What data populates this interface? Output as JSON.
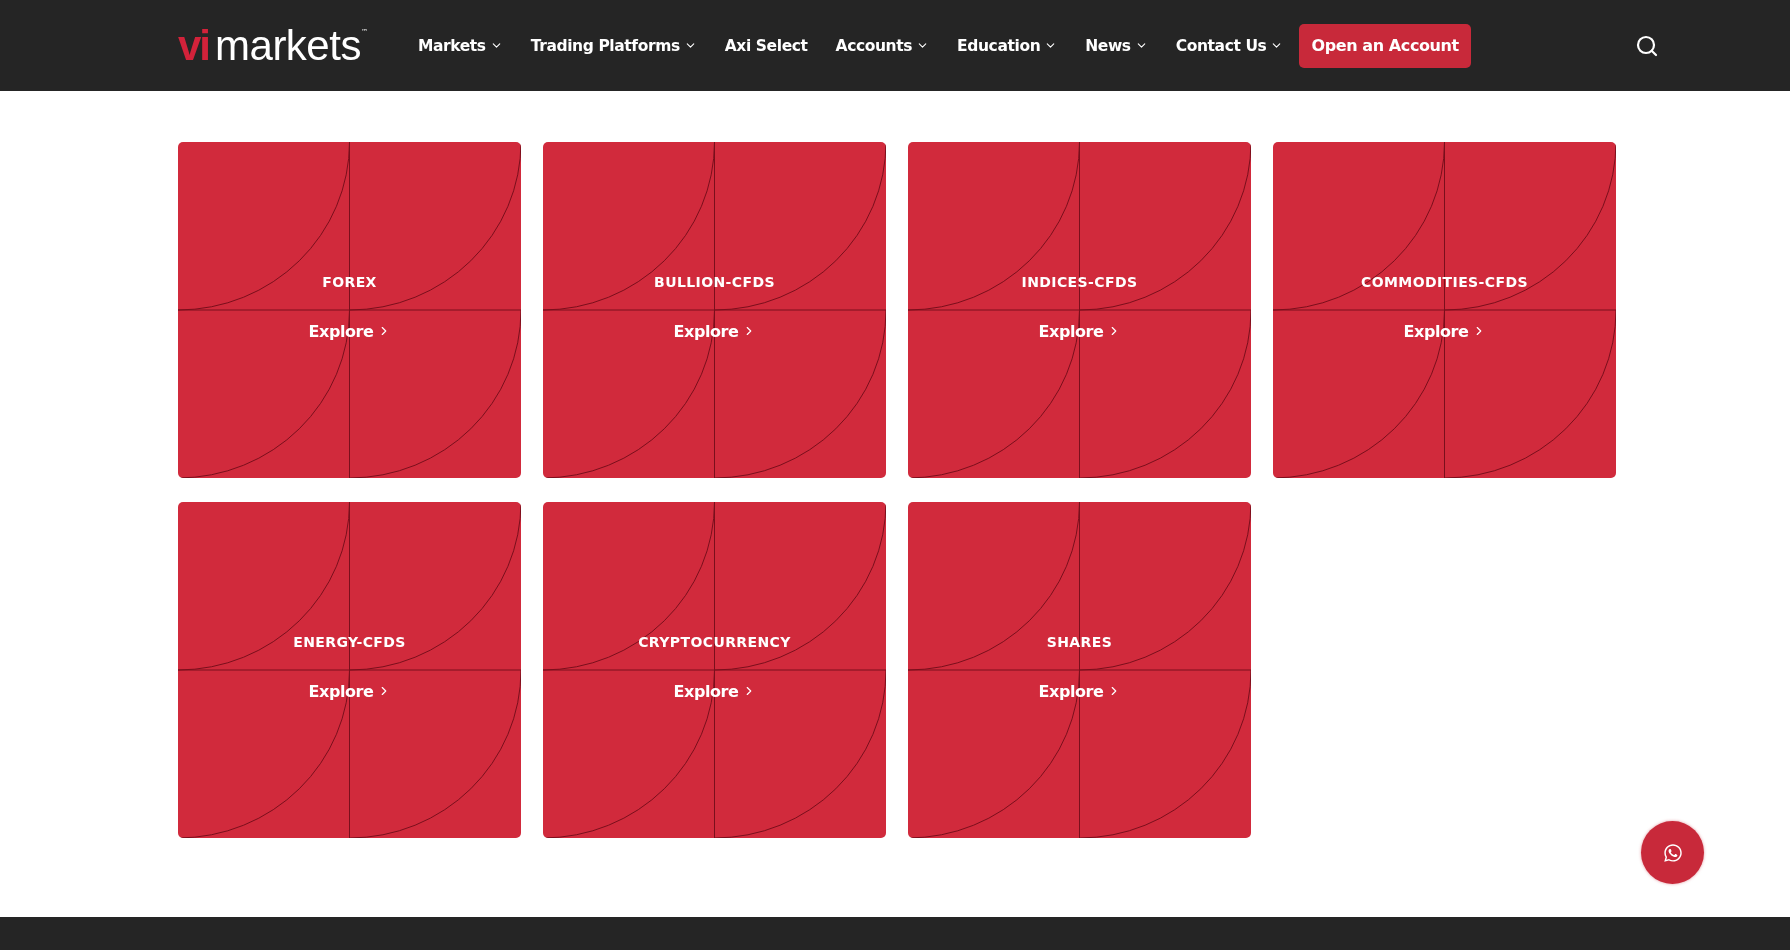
{
  "header": {
    "logo": {
      "accent": "vi",
      "text": "markets",
      "mark": "™"
    },
    "nav": [
      {
        "label": "Markets",
        "dropdown": true
      },
      {
        "label": "Trading Platforms",
        "dropdown": true
      },
      {
        "label": "Axi Select",
        "dropdown": false
      },
      {
        "label": "Accounts",
        "dropdown": true
      },
      {
        "label": "Education",
        "dropdown": true
      },
      {
        "label": "News",
        "dropdown": true
      },
      {
        "label": "Contact Us",
        "dropdown": true
      }
    ],
    "cta": "Open an Account"
  },
  "cards": [
    {
      "title": "FOREX",
      "link": "Explore"
    },
    {
      "title": "BULLION-CFDS",
      "link": "Explore"
    },
    {
      "title": "INDICES-CFDS",
      "link": "Explore"
    },
    {
      "title": "COMMODITIES-CFDS",
      "link": "Explore"
    },
    {
      "title": "ENERGY-CFDS",
      "link": "Explore"
    },
    {
      "title": "CRYPTOCURRENCY",
      "link": "Explore"
    },
    {
      "title": "SHARES",
      "link": "Explore"
    }
  ]
}
